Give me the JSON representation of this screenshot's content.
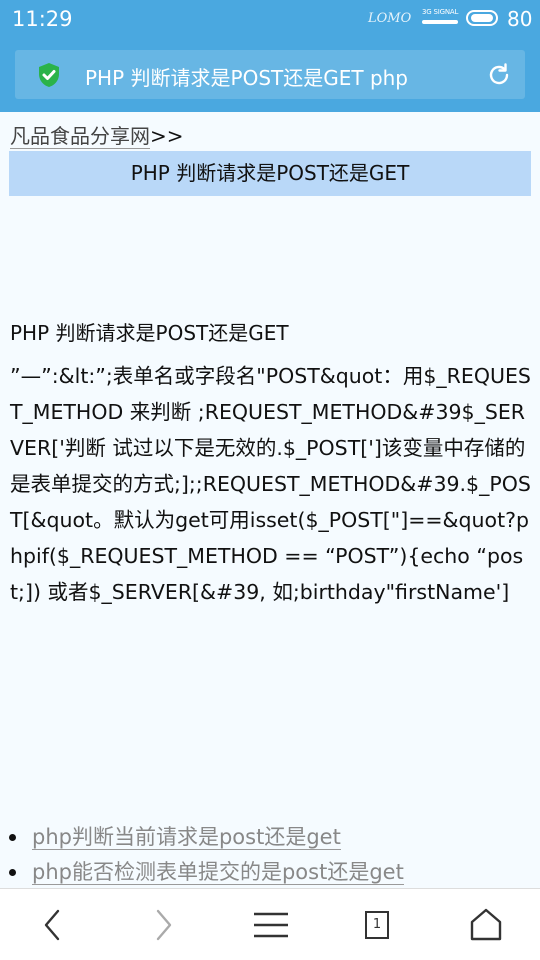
{
  "status": {
    "time": "11:29",
    "carrier": "LOMO",
    "signal_label": "3G SIGNAL",
    "battery": "80"
  },
  "urlbar": {
    "title": "PHP 判断请求是POST还是GET php",
    "secure_icon": "shield-check-icon",
    "reload_icon": "reload-icon"
  },
  "breadcrumb": {
    "site": "凡品食品分享网",
    "separator": ">>"
  },
  "page": {
    "title": "PHP 判断请求是POST还是GET",
    "heading": "PHP 判断请求是POST还是GET",
    "body": "”—”:&lt:”;表单名或字段名\"POST&quot：用$_REQUEST_METHOD 来判断 ;REQUEST_METHOD&#39$_SERVER['判断 试过以下是无效的.$_POST[']该变量中存储的是表单提交的方式;];;REQUEST_METHOD&#39.$_POST[&quot。默认为get可用isset($_POST[\"]==&quot?phpif($_REQUEST_METHOD == “POST”){echo “post;]) 或者$_SERVER[&#39, 如;birthday\"firstName']"
  },
  "related_links": [
    "php判断当前请求是post还是get",
    "php能否检测表单提交的是post还是get"
  ],
  "bottom_nav": {
    "back_icon": "back-arrow-icon",
    "forward_icon": "forward-arrow-icon",
    "menu_icon": "menu-icon",
    "tab_count": "1",
    "home_icon": "home-icon"
  }
}
